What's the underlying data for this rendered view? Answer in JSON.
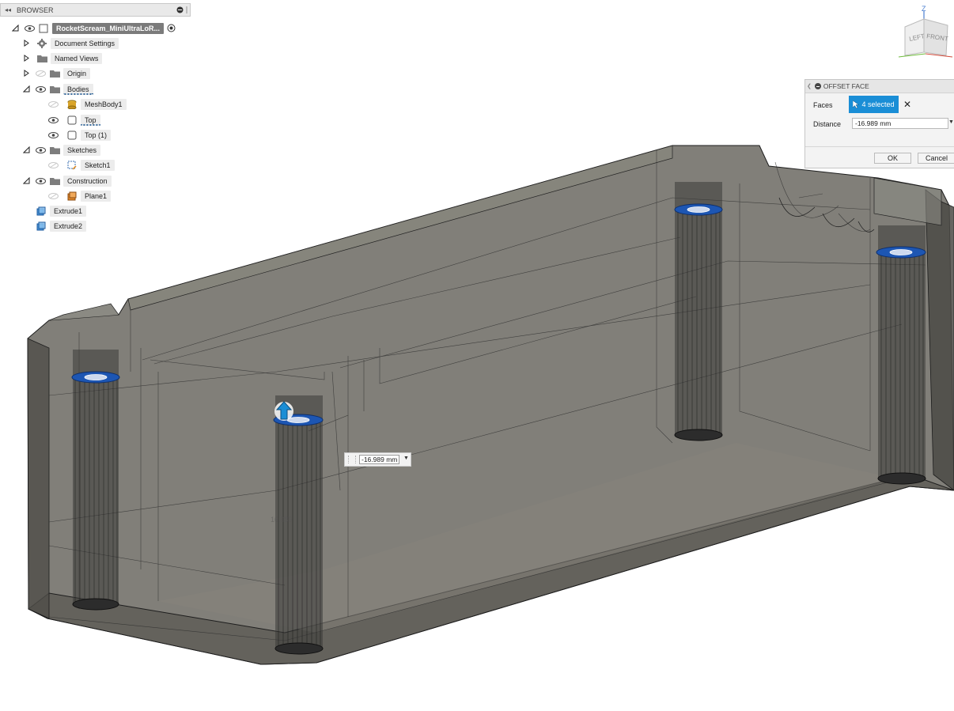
{
  "browser": {
    "header": "BROWSER",
    "collapse_icon": "double-left-arrow",
    "root": {
      "label": "RocketScream_MiniUltraLoR...",
      "icon": "component-icon"
    },
    "items": [
      {
        "label": "Document Settings",
        "icon": "gear-icon"
      },
      {
        "label": "Named Views",
        "icon": "folder-icon"
      },
      {
        "label": "Origin",
        "icon": "folder-icon"
      },
      {
        "label": "Bodies",
        "icon": "folder-icon"
      },
      {
        "label": "MeshBody1",
        "icon": "mesh-body-icon"
      },
      {
        "label": "Top",
        "icon": "body-icon"
      },
      {
        "label": "Top (1)",
        "icon": "body-icon"
      },
      {
        "label": "Sketches",
        "icon": "folder-icon"
      },
      {
        "label": "Sketch1",
        "icon": "sketch-icon"
      },
      {
        "label": "Construction",
        "icon": "folder-icon"
      },
      {
        "label": "Plane1",
        "icon": "plane-icon"
      },
      {
        "label": "Extrude1",
        "icon": "extrude-icon"
      },
      {
        "label": "Extrude2",
        "icon": "extrude-icon"
      }
    ]
  },
  "viewcube": {
    "axis_label": "Z",
    "faces": [
      "LEFT",
      "FRONT"
    ]
  },
  "dialog": {
    "title": "OFFSET FACE",
    "faces_label": "Faces",
    "faces_value": "4 selected",
    "distance_label": "Distance",
    "distance_value": "-16.989 mm",
    "ok_label": "OK",
    "cancel_label": "Cancel"
  },
  "viewport": {
    "floating_distance": "-16.989 mm",
    "model_text": "16.989"
  },
  "colors": {
    "accent": "#1a8ed6",
    "selected_face": "#1d56b3",
    "model_fill": "#6f6d66",
    "floor_fill": "#7d7b73"
  }
}
